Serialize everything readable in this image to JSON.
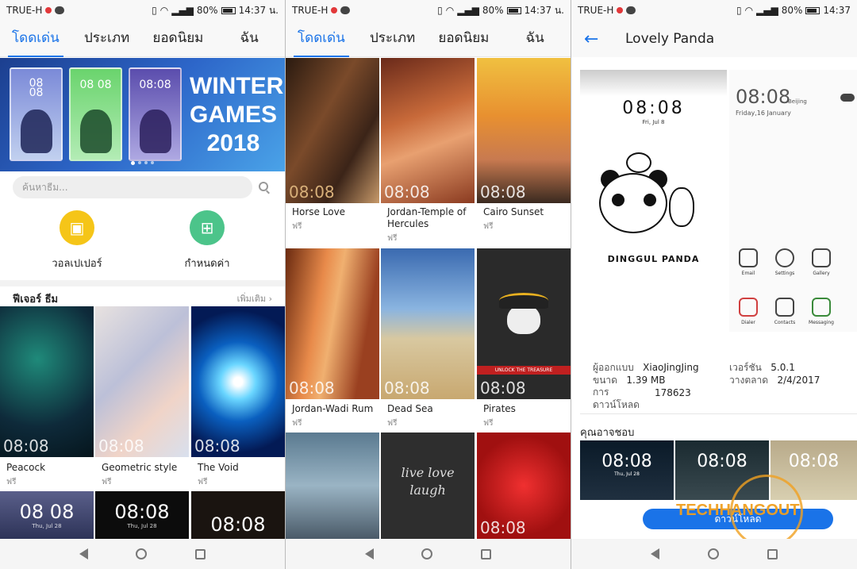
{
  "status": {
    "carrier": "TRUE-H",
    "battery": "80%",
    "time1": "14:37 น.",
    "time2": "14:37 น.",
    "time3": "14:37",
    "carrier3": "TRUE-H"
  },
  "tabs": [
    "โดดเด่น",
    "ประเภท",
    "ยอดนิยม",
    "ฉัน"
  ],
  "banner": {
    "title": "WINTER GAMES 2018",
    "card_clock1": "08\n08",
    "card_clock2": "08 08",
    "card_clock3": "08:08"
  },
  "search": {
    "placeholder": "ค้นหาธีม..."
  },
  "quick": [
    {
      "label": "วอลเปเปอร์",
      "color": "#f5c518"
    },
    {
      "label": "กำหนดค่า",
      "color": "#4cc48a"
    }
  ],
  "section": {
    "title": "ฟีเจอร์ ธีม",
    "more": "เพิ่มเติม"
  },
  "featured": [
    {
      "name": "Peacock",
      "price": "ฟรี",
      "time": "08:08"
    },
    {
      "name": "Geometric style",
      "price": "ฟรี",
      "time": "08:08"
    },
    {
      "name": "The Void",
      "price": "ฟรี",
      "time": "08:08"
    }
  ],
  "featured_row2": [
    {
      "time": "08 08",
      "date": "Thu, Jul 28"
    },
    {
      "time": "08:08",
      "date": "Thu, Jul 28"
    },
    {
      "time": "08:08",
      "date": ""
    }
  ],
  "grid": [
    {
      "name": "Horse Love",
      "price": "ฟรี",
      "time": "08:08"
    },
    {
      "name": "Jordan-Temple of Hercules",
      "price": "ฟรี",
      "time": "08:08"
    },
    {
      "name": "Cairo Sunset",
      "price": "ฟรี",
      "time": "08:08"
    },
    {
      "name": "Jordan-Wadi Rum",
      "price": "ฟรี",
      "time": "08:08"
    },
    {
      "name": "Dead Sea",
      "price": "ฟรี",
      "time": "08:08"
    },
    {
      "name": "Pirates",
      "price": "ฟรี",
      "time": "08:08"
    }
  ],
  "grid_row3": [
    {
      "text": ""
    },
    {
      "text": "live love laugh"
    },
    {
      "text": "08:08"
    }
  ],
  "pirates_banner": "UNLOCK THE TREASURE",
  "detail": {
    "title": "Lovely Panda",
    "preview_clock": "08:08",
    "preview_date": "Fri, Jul 8",
    "preview_label": "DINGGUL PANDA",
    "home_clock": "08:08",
    "home_city": "Beijing",
    "home_date": "Friday,16 January",
    "apps": [
      "Email",
      "Settings",
      "Gallery",
      "Dialer",
      "Contacts",
      "Messaging"
    ],
    "designer_label": "ผู้ออกแบบ",
    "designer": "XiaoJingJing",
    "version_label": "เวอร์ชัน",
    "version": "5.0.1",
    "size_label": "ขนาด",
    "size": "1.39 MB",
    "release_label": "วางตลาด",
    "release": "2/4/2017",
    "downloads_label1": "การ",
    "downloads_label2": "ดาวน์โหลด",
    "downloads": "178623",
    "suggest_title": "คุณอาจชอบ",
    "suggest": [
      {
        "time": "08:08",
        "date": "Thu, Jul 28"
      },
      {
        "time": "08:08",
        "date": ""
      },
      {
        "time": "08:08",
        "date": ""
      }
    ],
    "download_button": "ดาวน์โหลด",
    "watermark": "TECHHANGOUT"
  }
}
